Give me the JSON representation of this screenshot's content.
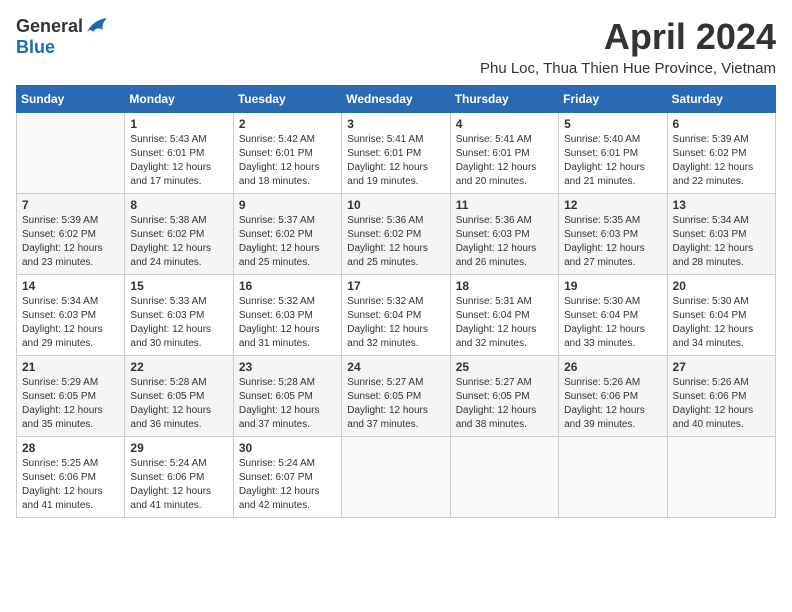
{
  "header": {
    "logo": {
      "general": "General",
      "blue": "Blue"
    },
    "title": "April 2024",
    "location": "Phu Loc, Thua Thien Hue Province, Vietnam"
  },
  "calendar": {
    "days_of_week": [
      "Sunday",
      "Monday",
      "Tuesday",
      "Wednesday",
      "Thursday",
      "Friday",
      "Saturday"
    ],
    "weeks": [
      [
        {
          "day": "",
          "sunrise": "",
          "sunset": "",
          "daylight": ""
        },
        {
          "day": "1",
          "sunrise": "Sunrise: 5:43 AM",
          "sunset": "Sunset: 6:01 PM",
          "daylight": "Daylight: 12 hours and 17 minutes."
        },
        {
          "day": "2",
          "sunrise": "Sunrise: 5:42 AM",
          "sunset": "Sunset: 6:01 PM",
          "daylight": "Daylight: 12 hours and 18 minutes."
        },
        {
          "day": "3",
          "sunrise": "Sunrise: 5:41 AM",
          "sunset": "Sunset: 6:01 PM",
          "daylight": "Daylight: 12 hours and 19 minutes."
        },
        {
          "day": "4",
          "sunrise": "Sunrise: 5:41 AM",
          "sunset": "Sunset: 6:01 PM",
          "daylight": "Daylight: 12 hours and 20 minutes."
        },
        {
          "day": "5",
          "sunrise": "Sunrise: 5:40 AM",
          "sunset": "Sunset: 6:01 PM",
          "daylight": "Daylight: 12 hours and 21 minutes."
        },
        {
          "day": "6",
          "sunrise": "Sunrise: 5:39 AM",
          "sunset": "Sunset: 6:02 PM",
          "daylight": "Daylight: 12 hours and 22 minutes."
        }
      ],
      [
        {
          "day": "7",
          "sunrise": "Sunrise: 5:39 AM",
          "sunset": "Sunset: 6:02 PM",
          "daylight": "Daylight: 12 hours and 23 minutes."
        },
        {
          "day": "8",
          "sunrise": "Sunrise: 5:38 AM",
          "sunset": "Sunset: 6:02 PM",
          "daylight": "Daylight: 12 hours and 24 minutes."
        },
        {
          "day": "9",
          "sunrise": "Sunrise: 5:37 AM",
          "sunset": "Sunset: 6:02 PM",
          "daylight": "Daylight: 12 hours and 25 minutes."
        },
        {
          "day": "10",
          "sunrise": "Sunrise: 5:36 AM",
          "sunset": "Sunset: 6:02 PM",
          "daylight": "Daylight: 12 hours and 25 minutes."
        },
        {
          "day": "11",
          "sunrise": "Sunrise: 5:36 AM",
          "sunset": "Sunset: 6:03 PM",
          "daylight": "Daylight: 12 hours and 26 minutes."
        },
        {
          "day": "12",
          "sunrise": "Sunrise: 5:35 AM",
          "sunset": "Sunset: 6:03 PM",
          "daylight": "Daylight: 12 hours and 27 minutes."
        },
        {
          "day": "13",
          "sunrise": "Sunrise: 5:34 AM",
          "sunset": "Sunset: 6:03 PM",
          "daylight": "Daylight: 12 hours and 28 minutes."
        }
      ],
      [
        {
          "day": "14",
          "sunrise": "Sunrise: 5:34 AM",
          "sunset": "Sunset: 6:03 PM",
          "daylight": "Daylight: 12 hours and 29 minutes."
        },
        {
          "day": "15",
          "sunrise": "Sunrise: 5:33 AM",
          "sunset": "Sunset: 6:03 PM",
          "daylight": "Daylight: 12 hours and 30 minutes."
        },
        {
          "day": "16",
          "sunrise": "Sunrise: 5:32 AM",
          "sunset": "Sunset: 6:03 PM",
          "daylight": "Daylight: 12 hours and 31 minutes."
        },
        {
          "day": "17",
          "sunrise": "Sunrise: 5:32 AM",
          "sunset": "Sunset: 6:04 PM",
          "daylight": "Daylight: 12 hours and 32 minutes."
        },
        {
          "day": "18",
          "sunrise": "Sunrise: 5:31 AM",
          "sunset": "Sunset: 6:04 PM",
          "daylight": "Daylight: 12 hours and 32 minutes."
        },
        {
          "day": "19",
          "sunrise": "Sunrise: 5:30 AM",
          "sunset": "Sunset: 6:04 PM",
          "daylight": "Daylight: 12 hours and 33 minutes."
        },
        {
          "day": "20",
          "sunrise": "Sunrise: 5:30 AM",
          "sunset": "Sunset: 6:04 PM",
          "daylight": "Daylight: 12 hours and 34 minutes."
        }
      ],
      [
        {
          "day": "21",
          "sunrise": "Sunrise: 5:29 AM",
          "sunset": "Sunset: 6:05 PM",
          "daylight": "Daylight: 12 hours and 35 minutes."
        },
        {
          "day": "22",
          "sunrise": "Sunrise: 5:28 AM",
          "sunset": "Sunset: 6:05 PM",
          "daylight": "Daylight: 12 hours and 36 minutes."
        },
        {
          "day": "23",
          "sunrise": "Sunrise: 5:28 AM",
          "sunset": "Sunset: 6:05 PM",
          "daylight": "Daylight: 12 hours and 37 minutes."
        },
        {
          "day": "24",
          "sunrise": "Sunrise: 5:27 AM",
          "sunset": "Sunset: 6:05 PM",
          "daylight": "Daylight: 12 hours and 37 minutes."
        },
        {
          "day": "25",
          "sunrise": "Sunrise: 5:27 AM",
          "sunset": "Sunset: 6:05 PM",
          "daylight": "Daylight: 12 hours and 38 minutes."
        },
        {
          "day": "26",
          "sunrise": "Sunrise: 5:26 AM",
          "sunset": "Sunset: 6:06 PM",
          "daylight": "Daylight: 12 hours and 39 minutes."
        },
        {
          "day": "27",
          "sunrise": "Sunrise: 5:26 AM",
          "sunset": "Sunset: 6:06 PM",
          "daylight": "Daylight: 12 hours and 40 minutes."
        }
      ],
      [
        {
          "day": "28",
          "sunrise": "Sunrise: 5:25 AM",
          "sunset": "Sunset: 6:06 PM",
          "daylight": "Daylight: 12 hours and 41 minutes."
        },
        {
          "day": "29",
          "sunrise": "Sunrise: 5:24 AM",
          "sunset": "Sunset: 6:06 PM",
          "daylight": "Daylight: 12 hours and 41 minutes."
        },
        {
          "day": "30",
          "sunrise": "Sunrise: 5:24 AM",
          "sunset": "Sunset: 6:07 PM",
          "daylight": "Daylight: 12 hours and 42 minutes."
        },
        {
          "day": "",
          "sunrise": "",
          "sunset": "",
          "daylight": ""
        },
        {
          "day": "",
          "sunrise": "",
          "sunset": "",
          "daylight": ""
        },
        {
          "day": "",
          "sunrise": "",
          "sunset": "",
          "daylight": ""
        },
        {
          "day": "",
          "sunrise": "",
          "sunset": "",
          "daylight": ""
        }
      ]
    ]
  }
}
